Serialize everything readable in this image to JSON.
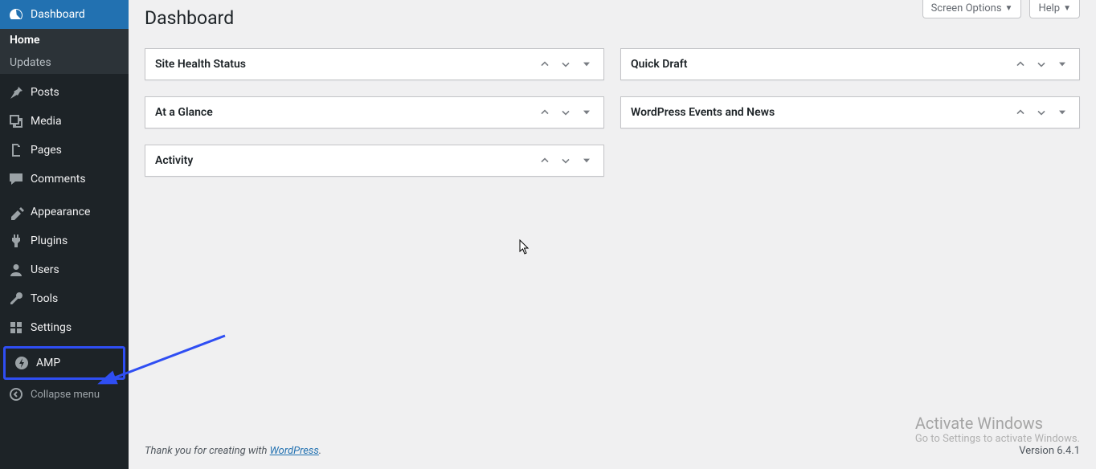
{
  "header": {
    "screen_options": "Screen Options",
    "help": "Help"
  },
  "page": {
    "title": "Dashboard"
  },
  "sidebar": {
    "items": [
      {
        "label": "Dashboard",
        "icon": "dashboard",
        "current": true
      },
      {
        "label": "Posts",
        "icon": "pin"
      },
      {
        "label": "Media",
        "icon": "media"
      },
      {
        "label": "Pages",
        "icon": "pages"
      },
      {
        "label": "Comments",
        "icon": "comments"
      },
      {
        "label": "Appearance",
        "icon": "appearance"
      },
      {
        "label": "Plugins",
        "icon": "plugins"
      },
      {
        "label": "Users",
        "icon": "users"
      },
      {
        "label": "Tools",
        "icon": "tools"
      },
      {
        "label": "Settings",
        "icon": "settings"
      },
      {
        "label": "AMP",
        "icon": "amp",
        "highlight": true
      }
    ],
    "submenu": [
      {
        "label": "Home",
        "current": true
      },
      {
        "label": "Updates"
      }
    ],
    "collapse": "Collapse menu"
  },
  "widgets": {
    "col1": [
      {
        "title": "Site Health Status"
      },
      {
        "title": "At a Glance"
      },
      {
        "title": "Activity"
      }
    ],
    "col2": [
      {
        "title": "Quick Draft"
      },
      {
        "title": "WordPress Events and News"
      }
    ]
  },
  "footer": {
    "thanks_prefix": "Thank you for creating with ",
    "thanks_link": "WordPress",
    "thanks_suffix": ".",
    "version": "Version 6.4.1"
  },
  "watermark": {
    "line1": "Activate Windows",
    "line2": "Go to Settings to activate Windows."
  }
}
